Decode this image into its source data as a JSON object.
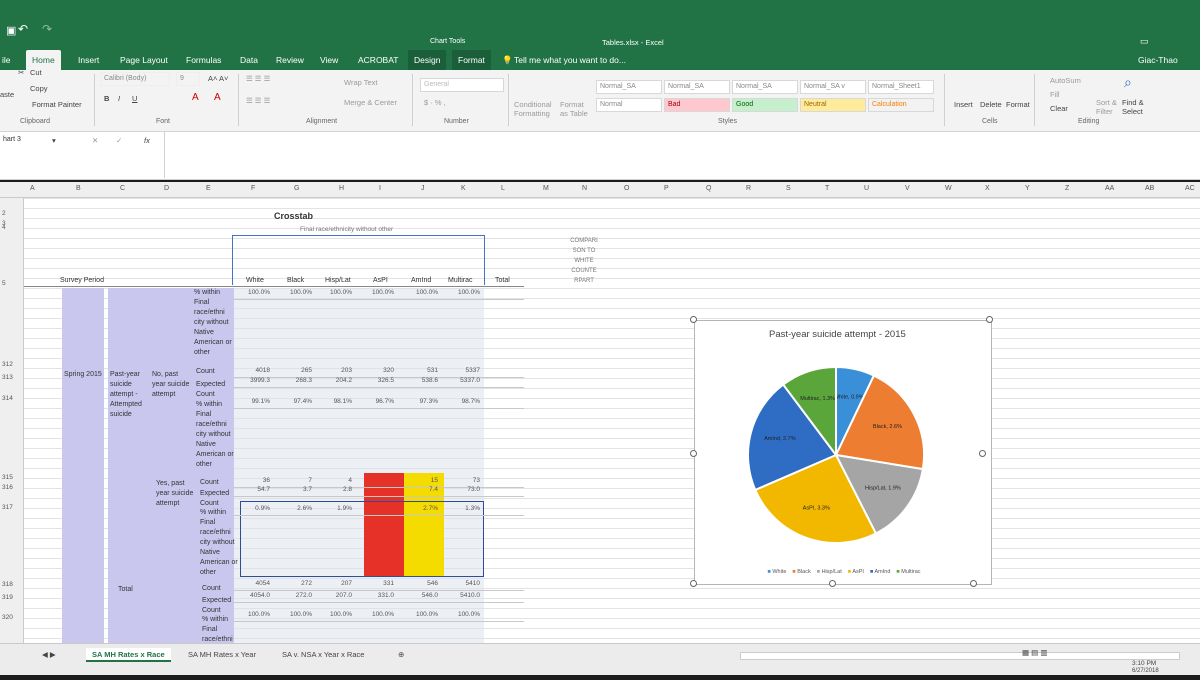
{
  "window": {
    "title": "Tables.xlsx - Excel",
    "context_label": "Chart Tools",
    "user": "Giac-Thao Tran",
    "tell_me": "Tell me what you want to do..."
  },
  "tabs": [
    "ile",
    "Home",
    "Insert",
    "Page Layout",
    "Formulas",
    "Data",
    "Review",
    "View",
    "ACROBAT",
    "Design",
    "Format"
  ],
  "ribbon": {
    "clipboard": {
      "cut": "Cut",
      "copy": "Copy",
      "paste": "aste",
      "format_painter": "Format Painter",
      "label": "Clipboard"
    },
    "font": {
      "name": "Calibri (Body)",
      "size": "9",
      "label": "Font"
    },
    "alignment": {
      "wrap": "Wrap Text",
      "merge": "Merge & Center",
      "label": "Alignment"
    },
    "number": {
      "format": "General",
      "label": "Number"
    },
    "cond": {
      "conditional": "Conditional Formatting",
      "format_as": "Format as Table"
    },
    "styles": {
      "label": "Styles",
      "cells": [
        "Normal_SA",
        "Normal_SA",
        "Normal_SA",
        "Normal_SA v",
        "Normal_Sheet1",
        "Normal",
        "Bad",
        "Good",
        "Neutral",
        "Calculation"
      ]
    },
    "cells_group": {
      "insert": "Insert",
      "delete": "Delete",
      "format": "Format",
      "label": "Cells"
    },
    "editing": {
      "autosum": "AutoSum",
      "fill": "Fill",
      "clear": "Clear",
      "sort": "Sort & Filter",
      "find": "Find & Select",
      "label": "Editing"
    }
  },
  "formula": {
    "name_box": "hart 3",
    "fx": "fx"
  },
  "columns": [
    "A",
    "B",
    "C",
    "D",
    "E",
    "F",
    "G",
    "H",
    "I",
    "J",
    "K",
    "L",
    "M",
    "N",
    "O",
    "P",
    "Q",
    "R",
    "S",
    "T",
    "U",
    "V",
    "W",
    "X",
    "Y",
    "Z",
    "AA",
    "AB",
    "AC"
  ],
  "rows": [
    "2",
    "3",
    "4",
    "5",
    "312",
    "313",
    "314",
    "315",
    "316",
    "317",
    "318",
    "319",
    "320"
  ],
  "crosstab": {
    "title": "Crosstab",
    "subtitle": "Final race/ethnicity without other",
    "survey_period": "Survey Period",
    "period": "Spring 2015",
    "var_label": "Past-year suicide attempt - Attempted suicide",
    "no_label": "No, past year suicide attempt",
    "yes_label": "Yes, past year suicide attempt",
    "total_label": "Total",
    "headers": [
      "White",
      "Black",
      "Hisp/Lat",
      "AsPI",
      "AmInd",
      "Multirac",
      "Total"
    ],
    "comparison": "COMPARI SON TO WHITE COUNTE RPART",
    "pct_label": "% within Final race/ethni city without Native American or other",
    "count_label": "Count",
    "expected_label": "Expected Count",
    "pct_row_top": [
      "100.0%",
      "100.0%",
      "100.0%",
      "100.0%",
      "100.0%",
      "100.0%"
    ],
    "no_count": [
      "4018",
      "265",
      "203",
      "320",
      "531",
      "5337"
    ],
    "no_expected": [
      "3999.3",
      "268.3",
      "204.2",
      "326.5",
      "538.6",
      "5337.0"
    ],
    "no_pct": [
      "99.1%",
      "97.4%",
      "98.1%",
      "96.7%",
      "97.3%",
      "98.7%"
    ],
    "yes_count": [
      "36",
      "7",
      "4",
      "",
      "15",
      "73"
    ],
    "yes_expected": [
      "54.7",
      "3.7",
      "2.8",
      "",
      "7.4",
      "73.0"
    ],
    "yes_pct": [
      "0.9%",
      "2.6%",
      "1.9%",
      "",
      "2.7%",
      "1.3%"
    ],
    "total_count": [
      "4054",
      "272",
      "207",
      "331",
      "546",
      "5410"
    ],
    "total_expected": [
      "4054.0",
      "272.0",
      "207.0",
      "331.0",
      "546.0",
      "5410.0"
    ],
    "total_pct": [
      "100.0%",
      "100.0%",
      "100.0%",
      "100.0%",
      "100.0%",
      "100.0%"
    ]
  },
  "chart_data": {
    "type": "pie",
    "title": "Past-year suicide attempt - 2015",
    "categories": [
      "White",
      "Black",
      "Hisp/Lat",
      "AsPI",
      "AmInd",
      "Multirac"
    ],
    "values": [
      0.9,
      2.6,
      1.9,
      3.3,
      2.7,
      1.3
    ],
    "labels": [
      "White, 0.9%",
      "Black, 2.6%",
      "Hisp/Lat, 1.9%",
      "AsPI, 3.3%",
      "AmInd, 2.7%",
      "Multirac, 1.3%"
    ],
    "colors": [
      "#3a8fd9",
      "#ed7d31",
      "#a5a5a5",
      "#f2b800",
      "#2f6cc4",
      "#5aa63a"
    ],
    "legend": "bottom"
  },
  "sheets": [
    "SA MH Rates x Race",
    "SA MH Rates x Year",
    "SA v. NSA x Year x Race"
  ],
  "status": {
    "time": "3:10 PM",
    "date": "6/27/2018"
  }
}
